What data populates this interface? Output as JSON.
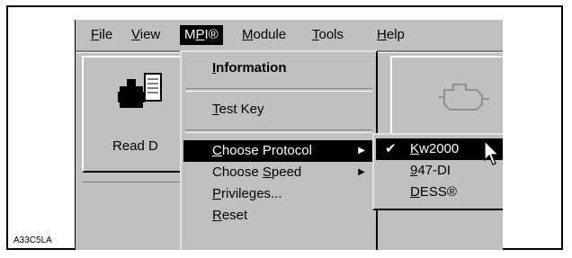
{
  "figure": {
    "code": "A33C5LA"
  },
  "menubar": {
    "items": [
      {
        "label": "File"
      },
      {
        "label": "View"
      },
      {
        "label": "MPI®"
      },
      {
        "label": "Module"
      },
      {
        "label": "Tools"
      },
      {
        "label": "Help"
      }
    ]
  },
  "toolbar": {
    "read_label": "Read D"
  },
  "mpi_menu": {
    "items": [
      {
        "label": "Information"
      },
      {
        "label": "Test Key"
      },
      {
        "label": "Choose Protocol"
      },
      {
        "label": "Choose Speed"
      },
      {
        "label": "Privileges..."
      },
      {
        "label": "Reset"
      }
    ]
  },
  "protocol_menu": {
    "items": [
      {
        "label": "Kw2000",
        "checked": true
      },
      {
        "label": "947-DI",
        "checked": false
      },
      {
        "label": "DESS®",
        "checked": false
      }
    ]
  },
  "icons": {
    "arrow": "submenu-arrow-icon",
    "check": "check-icon",
    "cursor": "mouse-pointer-icon"
  }
}
